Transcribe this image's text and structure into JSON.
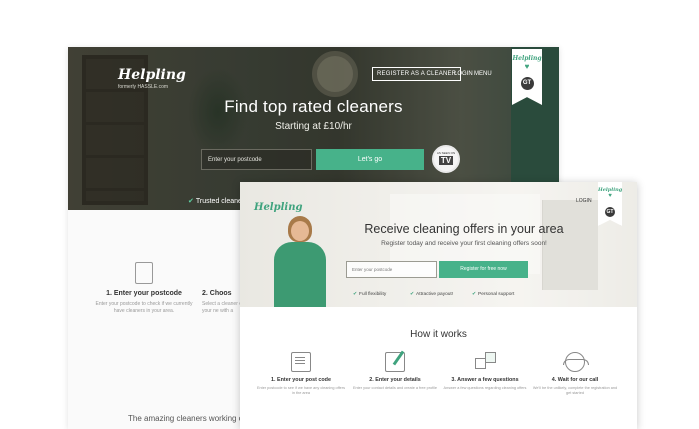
{
  "back": {
    "logo": "Helpling",
    "logo_sub": "formerly HASSLE.com",
    "nav": {
      "register": "REGISTER AS A CLEANER",
      "login": "LOGIN",
      "menu": "MENU"
    },
    "ribbon": {
      "brand": "Helpling",
      "heart": "♥",
      "badge": "GT"
    },
    "hero": {
      "title": "Find top rated cleaners",
      "subtitle": "Starting at £10/hr",
      "postcode_placeholder": "Enter your postcode",
      "cta": "Let's go",
      "tv_top": "AS SEEN ON",
      "tv": "TV",
      "trusted": "Trusted cleaner"
    },
    "steps": [
      {
        "title": "1. Enter your postcode",
        "desc": "Enter your postcode to check if we currently have cleaners in your area."
      },
      {
        "title": "2. Choos",
        "desc": "Select a cleaner on your ne with a"
      }
    ],
    "footer_text": "The amazing cleaners working on"
  },
  "front": {
    "logo": "Helpling",
    "login": "LOGIN",
    "ribbon": {
      "brand": "Helpling",
      "heart": "♥",
      "badge": "GT"
    },
    "hero": {
      "title": "Receive cleaning offers in your area",
      "subtitle": "Register today and receive your first cleaning offers soon!",
      "postcode_placeholder": "Enter your postcode",
      "cta": "Register for free now",
      "features": [
        "Full flexibility",
        "Attractive payout!",
        "Personal support"
      ]
    },
    "how_title": "How it works",
    "steps": [
      {
        "title": "1. Enter your post code",
        "desc": "Enter postcode to see if we have any cleaning offers in the area"
      },
      {
        "title": "2. Enter your details",
        "desc": "Enter your contact details and create a free profile"
      },
      {
        "title": "3. Answer a few questions",
        "desc": "Answer a few questions regarding cleaning offers"
      },
      {
        "title": "4. Wait for our call",
        "desc": "We'll be the unlikely, complete the registration and get started"
      }
    ]
  },
  "colors": {
    "accent": "#47b28a",
    "brand_green": "#3fa37e",
    "text_dark": "#333333"
  }
}
